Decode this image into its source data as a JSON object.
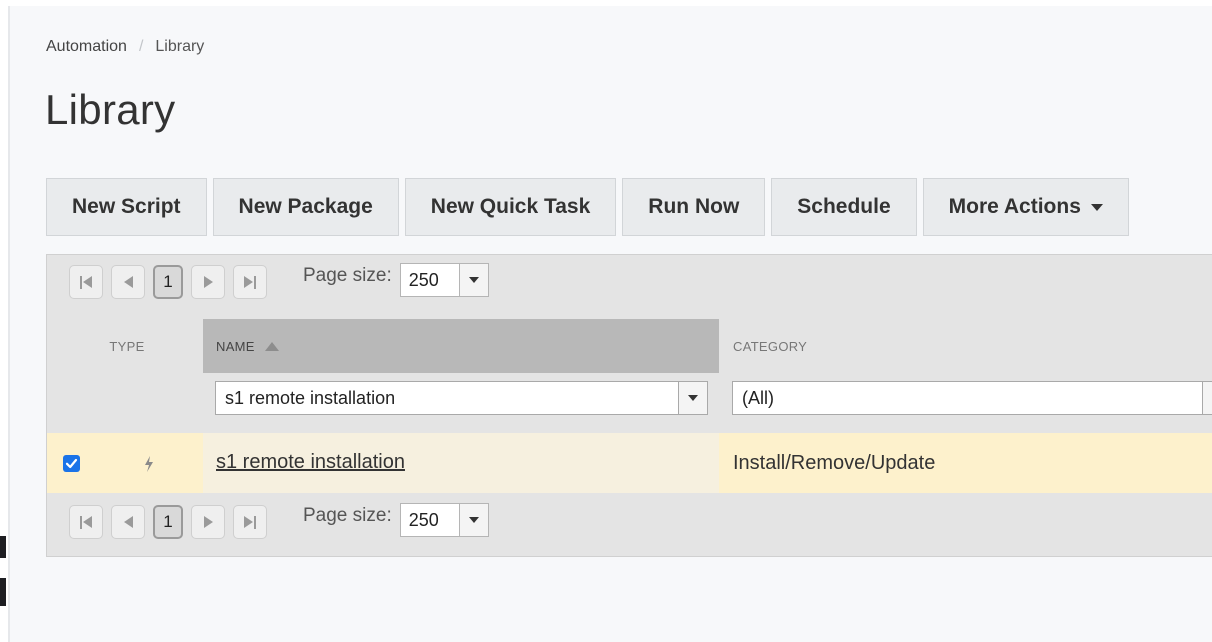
{
  "breadcrumb": {
    "parent": "Automation",
    "separator": "/",
    "current": "Library"
  },
  "page_title": "Library",
  "toolbar": {
    "new_script": "New Script",
    "new_package": "New Package",
    "new_quick_task": "New Quick Task",
    "run_now": "Run Now",
    "schedule": "Schedule",
    "more_actions": "More Actions"
  },
  "pager": {
    "current_page": "1",
    "page_size_label": "Page size:",
    "page_size": "250"
  },
  "columns": {
    "type": "TYPE",
    "name": "NAME",
    "category": "CATEGORY",
    "sorted_by": "name",
    "sort_direction": "ascending"
  },
  "filters": {
    "name": "s1 remote installation",
    "category": "(All)"
  },
  "rows": [
    {
      "checked": true,
      "type_icon": "lightning-bolt-icon",
      "name": "s1 remote installation",
      "category": "Install/Remove/Update"
    }
  ],
  "colors": {
    "accent": "#1a73e8",
    "selected_row": "#fdf1cc",
    "sorted_header": "#b8b8b8"
  }
}
